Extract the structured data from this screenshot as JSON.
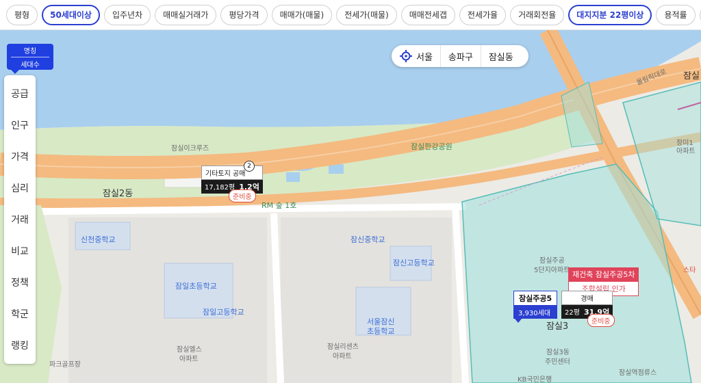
{
  "filters": [
    {
      "label": "평형",
      "active": false
    },
    {
      "label": "50세대이상",
      "active": true
    },
    {
      "label": "입주년차",
      "active": false
    },
    {
      "label": "매매실거래가",
      "active": false
    },
    {
      "label": "평당가격",
      "active": false
    },
    {
      "label": "매매가(매물)",
      "active": false
    },
    {
      "label": "전세가(매물)",
      "active": false
    },
    {
      "label": "매매전세갭",
      "active": false
    },
    {
      "label": "전세가율",
      "active": false
    },
    {
      "label": "거래회전율",
      "active": false
    },
    {
      "label": "대지지분 22평이상",
      "active": true
    },
    {
      "label": "용적률",
      "active": false
    },
    {
      "label": "건폐율",
      "active": false
    }
  ],
  "layer_toggle": {
    "top": "명칭",
    "bottom": "세대수"
  },
  "side_menu": [
    "공급",
    "인구",
    "가격",
    "심리",
    "거래",
    "비교",
    "정책",
    "학군",
    "랭킹"
  ],
  "location": {
    "city": "서울",
    "district": "송파구",
    "dong": "잠실동"
  },
  "labels": {
    "jamsil2dong": "잠실2동",
    "jamsil3dong": "잠실3",
    "cruise": "잠실이크루즈",
    "hangang_park": "잠실한강공원",
    "rm_forest": "RM 숲 1호",
    "olympic_road": "올림픽대로",
    "sincheon_ms": "신천중학교",
    "jamsin_ms": "잠신중학교",
    "jamsin_hs": "잠신고등학교",
    "jamil_es": "잠일초등학교",
    "jamil_hs": "잠일고등학교",
    "seoul_jamsin_es_1": "서울잠신",
    "seoul_jamsin_es_2": "초등학교",
    "jamsil_els_1": "잠실엘스",
    "jamsil_els_2": "아파트",
    "park_golf": "파크골프장",
    "jamsil_ricents_1": "잠실리센츠",
    "jamsil_ricents_2": "아파트",
    "jamsil5_1": "잠실주공",
    "jamsil5_2": "5단지아파트",
    "jamsil3dong_center_1": "잠실3동",
    "jamsil3dong_center_2": "주민센터",
    "jamsil_station": "잠실역점류스",
    "kb_bank": "KB국민은행",
    "jangmi_1": "장미1",
    "jangmi_2": "아파트",
    "star": "스타",
    "jamsil_top": "잠실"
  },
  "callout_land": {
    "title": "기타토지",
    "type": "공매",
    "area": "17,182평",
    "price": "1.2억",
    "status": "준비중",
    "count": "2"
  },
  "callout_red": {
    "line1": "재건축 잠실주공5차",
    "line2": "조합설립 인가"
  },
  "callout_blue": {
    "name": "잠실주공5",
    "households": "3,930세대"
  },
  "callout_auction": {
    "type": "경매",
    "area": "22평",
    "price": "31.9억",
    "status": "준비중"
  },
  "colors": {
    "accent": "#2b3fd0",
    "water": "#a8cdee",
    "park": "#d7e9c4",
    "road": "#f3b87a",
    "highlight": "#9fe0dc"
  }
}
